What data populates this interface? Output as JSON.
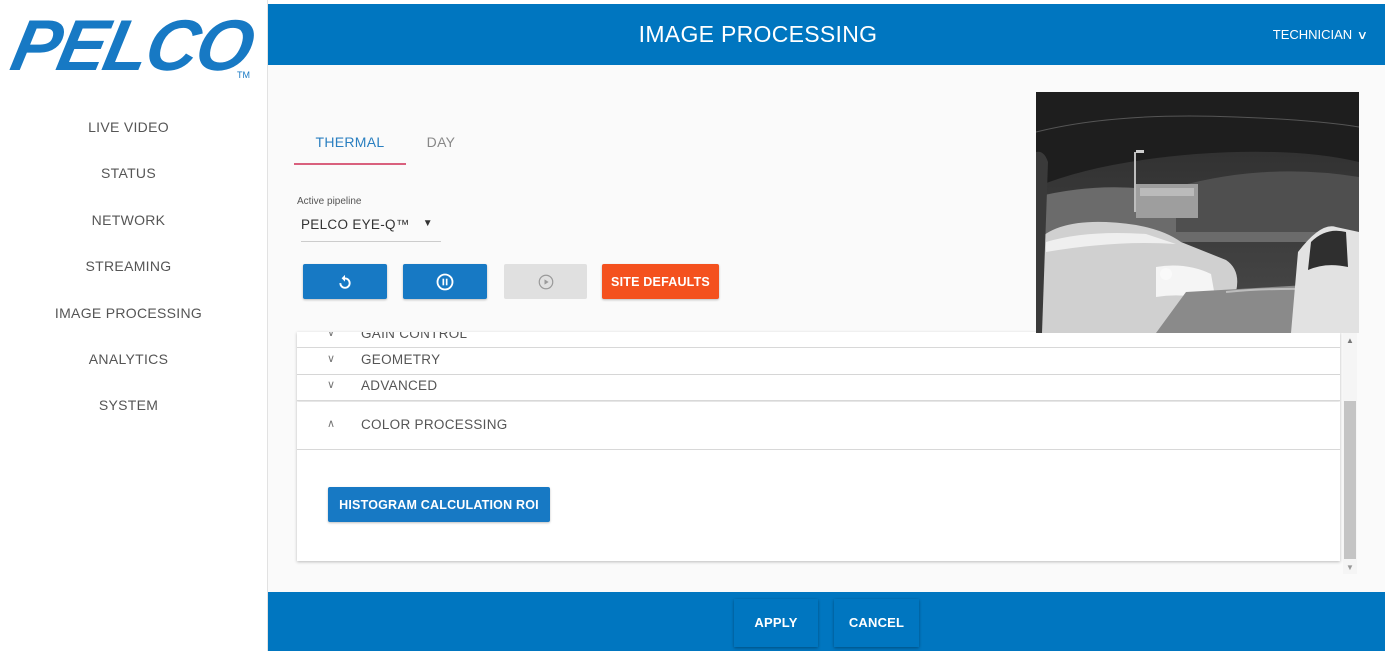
{
  "brand": {
    "logo_text": "PELCO",
    "trademark": "TM",
    "color": "#1779c4"
  },
  "sidebar": {
    "items": [
      {
        "label": "LIVE VIDEO"
      },
      {
        "label": "STATUS"
      },
      {
        "label": "NETWORK"
      },
      {
        "label": "STREAMING"
      },
      {
        "label": "IMAGE PROCESSING"
      },
      {
        "label": "ANALYTICS"
      },
      {
        "label": "SYSTEM"
      }
    ]
  },
  "header": {
    "title": "IMAGE PROCESSING",
    "user": "TECHNICIAN",
    "user_icon": "chevron-down-icon",
    "color": "#0076c0"
  },
  "tabs": [
    {
      "label": "THERMAL",
      "active": true
    },
    {
      "label": "DAY",
      "active": false
    }
  ],
  "pipeline": {
    "label": "Active pipeline",
    "value": "PELCO EYE-Q™"
  },
  "controls": {
    "reset_icon": "reset-icon",
    "pause_icon": "pause-icon",
    "play_icon": "play-icon",
    "site_defaults_label": "SITE DEFAULTS",
    "site_defaults_color": "#f4511e"
  },
  "accordion": {
    "sections": [
      {
        "label": "GAIN CONTROL",
        "expanded": false
      },
      {
        "label": "GEOMETRY",
        "expanded": false
      },
      {
        "label": "ADVANCED",
        "expanded": false
      },
      {
        "label": "COLOR PROCESSING",
        "expanded": true
      }
    ],
    "histogram_button": "HISTOGRAM CALCULATION ROI"
  },
  "footer": {
    "apply_label": "APPLY",
    "cancel_label": "CANCEL"
  }
}
